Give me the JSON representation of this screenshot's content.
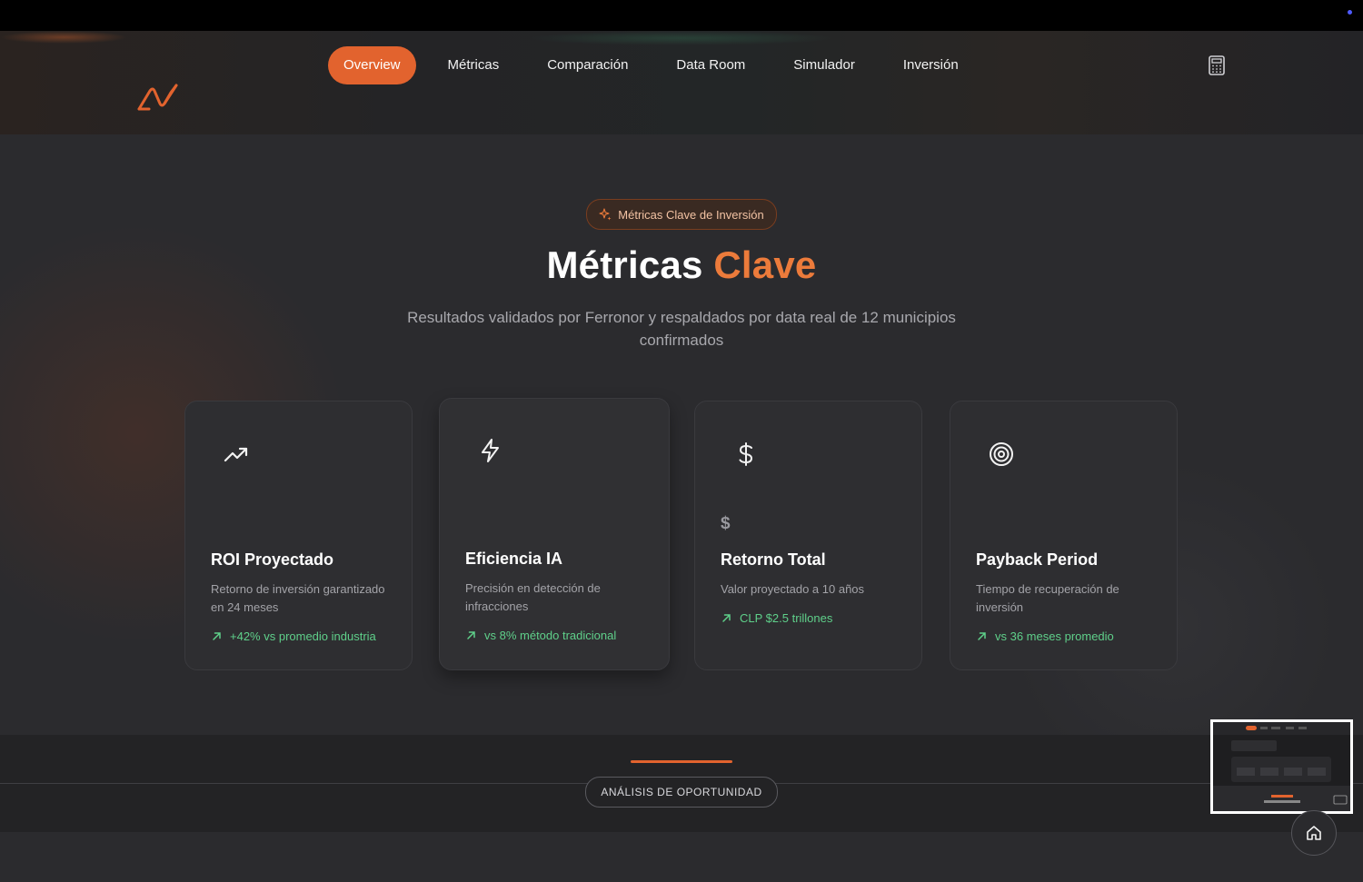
{
  "nav": {
    "items": [
      {
        "label": "Overview",
        "active": true
      },
      {
        "label": "Métricas"
      },
      {
        "label": "Comparación"
      },
      {
        "label": "Data Room"
      },
      {
        "label": "Simulador"
      },
      {
        "label": "Inversión"
      }
    ],
    "logo_icon": "brand-logo-icon",
    "calculator_icon": "calculator-icon"
  },
  "hero": {
    "badge": "Métricas Clave de Inversión",
    "title_main": "Métricas",
    "title_accent": "Clave",
    "subtitle": "Resultados validados por Ferronor y respaldados por data real de 12 municipios confirmados"
  },
  "cards": [
    {
      "icon": "trending-up-icon",
      "name": "ROI Proyectado",
      "description": "Retorno de inversión garantizado en 24 meses",
      "trend": "+42% vs promedio industria"
    },
    {
      "icon": "lightning-icon",
      "name": "Eficiencia IA",
      "description": "Precisión en detección de infracciones",
      "trend": "vs 8% método tradicional"
    },
    {
      "icon": "dollar-icon",
      "value_symbol": "$",
      "name": "Retorno Total",
      "description": "Valor proyectado a 10 años",
      "trend": "CLP $2.5 trillones"
    },
    {
      "icon": "target-icon",
      "name": "Payback Period",
      "description": "Tiempo de recuperación de inversión",
      "trend": "vs 36 meses promedio"
    }
  ],
  "section2": {
    "label": "ANÁLISIS DE OPORTUNIDAD"
  },
  "colors": {
    "accent": "#e2632e",
    "title_accent": "#ec7b3b",
    "trend_green": "#5fd08a"
  }
}
